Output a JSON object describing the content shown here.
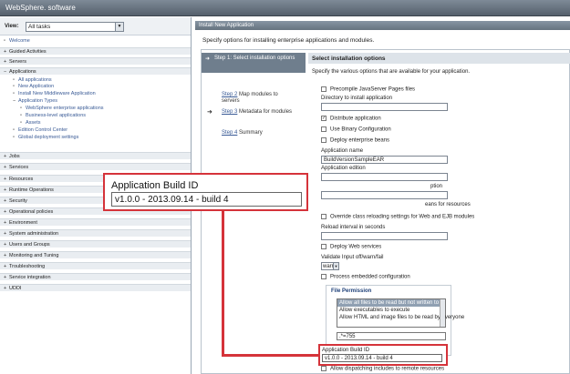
{
  "banner": {
    "brand": "WebSphere.",
    "brand_suffix": " software"
  },
  "nav": {
    "views_label": "View:",
    "views_value": "All tasks",
    "rows": [
      {
        "text": "Welcome",
        "kind": "link",
        "pm": "▫"
      },
      {
        "text": "Guided Activities",
        "kind": "cat",
        "pm": "+"
      },
      {
        "text": "Servers",
        "kind": "cat",
        "pm": "+"
      },
      {
        "text": "Applications",
        "kind": "cat",
        "pm": "−"
      },
      {
        "text": "All applications",
        "kind": "sub",
        "pm": "▫"
      },
      {
        "text": "New Application",
        "kind": "sub",
        "pm": "▫"
      },
      {
        "text": "Install New Middleware Application",
        "kind": "sub",
        "pm": "▫"
      },
      {
        "text": "Application Types",
        "kind": "sub",
        "pm": "−"
      },
      {
        "text": "WebSphere enterprise applications",
        "kind": "sub2",
        "pm": "▫"
      },
      {
        "text": "Business-level applications",
        "kind": "sub2",
        "pm": "▫"
      },
      {
        "text": "Assets",
        "kind": "sub2",
        "pm": "▫"
      },
      {
        "text": "Edition Control Center",
        "kind": "sub",
        "pm": "▫"
      },
      {
        "text": "Global deployment settings",
        "kind": "sub",
        "pm": "▫"
      },
      {
        "text": "Jobs",
        "kind": "cat",
        "pm": "+"
      },
      {
        "text": "Services",
        "kind": "cat",
        "pm": "+"
      },
      {
        "text": "Resources",
        "kind": "cat",
        "pm": "+"
      },
      {
        "text": "Runtime Operations",
        "kind": "cat",
        "pm": "+"
      },
      {
        "text": "Security",
        "kind": "cat",
        "pm": "+"
      },
      {
        "text": "Operational policies",
        "kind": "cat",
        "pm": "+"
      },
      {
        "text": "Environment",
        "kind": "cat",
        "pm": "+"
      },
      {
        "text": "System administration",
        "kind": "cat",
        "pm": "+"
      },
      {
        "text": "Users and Groups",
        "kind": "cat",
        "pm": "+"
      },
      {
        "text": "Monitoring and Tuning",
        "kind": "cat",
        "pm": "+"
      },
      {
        "text": "Troubleshooting",
        "kind": "cat",
        "pm": "+"
      },
      {
        "text": "Service integration",
        "kind": "cat",
        "pm": "+"
      },
      {
        "text": "UDDI",
        "kind": "cat",
        "pm": "+"
      }
    ]
  },
  "main": {
    "crumb": "Install New Application",
    "intro": "Specify options for installing enterprise applications and modules.",
    "steps": {
      "s1": "Step 1: Select installation options",
      "s2_link": "Step 2",
      "s2_rest": " Map modules to servers",
      "s3_link": "Step 3",
      "s3_rest": " Metadata for modules",
      "s4_link": "Step 4",
      "s4_rest": " Summary"
    },
    "opts_title": "Select installation options",
    "opts_desc": "Specify the various options that are available for your application.",
    "precompile": "Precompile JavaServer Pages files",
    "dir_label": "Directory to install application",
    "distribute": "Distribute application",
    "binary": "Use Binary Configuration",
    "deploy_beans": "Deploy enterprise beans",
    "app_name_label": "Application name",
    "app_name_value": "BuildVersionSampleEAR",
    "edition_label": "Application edition",
    "partial_ption": "ption",
    "partial_beans": "eans for resources",
    "override": "Override class reloading settings for Web and EJB modules",
    "reload_label": "Reload interval in seconds",
    "deploy_ws": "Deploy Web services",
    "validate_label": "Validate Input off/warn/fail",
    "validate_value": "warn",
    "process_embedded": "Process embedded configuration",
    "file_permission": {
      "title": "File Permission",
      "options": [
        "Allow all files to be read but not written to",
        "Allow executables to execute",
        "Allow HTML and image files to be read by everyone"
      ],
      "mask": ".*=755"
    },
    "build_id_label": "Application Build ID",
    "build_id_value": "v1.0.0 - 2013.09.14 - build 4",
    "dispatching": "Allow dispatching includes to remote resources"
  },
  "callout": {
    "title": "Application Build ID",
    "value": "v1.0.0 - 2013.09.14 - build 4"
  }
}
